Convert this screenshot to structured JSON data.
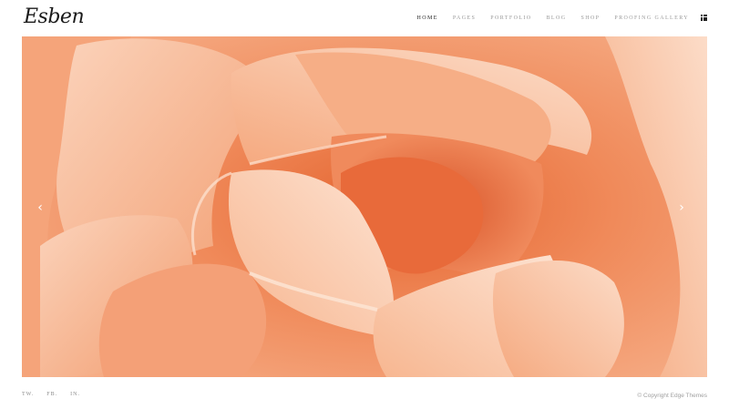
{
  "header": {
    "logo_text": "Esben",
    "nav": [
      {
        "label": "HOME",
        "active": true
      },
      {
        "label": "PAGES",
        "active": false
      },
      {
        "label": "PORTFOLIO",
        "active": false
      },
      {
        "label": "BLOG",
        "active": false
      },
      {
        "label": "SHOP",
        "active": false
      },
      {
        "label": "PROOFING GALLERY",
        "active": false
      }
    ],
    "menu_icon": "grid-icon"
  },
  "slider": {
    "image_subject": "peach rose close-up",
    "prev_arrow": "‹",
    "next_arrow": "›",
    "colors": {
      "dark": "#e86a3a",
      "mid": "#f39467",
      "light": "#f8bb98",
      "pale": "#fbd6bf"
    }
  },
  "footer": {
    "social": [
      {
        "label": "TW."
      },
      {
        "label": "FB."
      },
      {
        "label": "IN."
      }
    ],
    "copyright": "© Copyright Edge Themes"
  }
}
